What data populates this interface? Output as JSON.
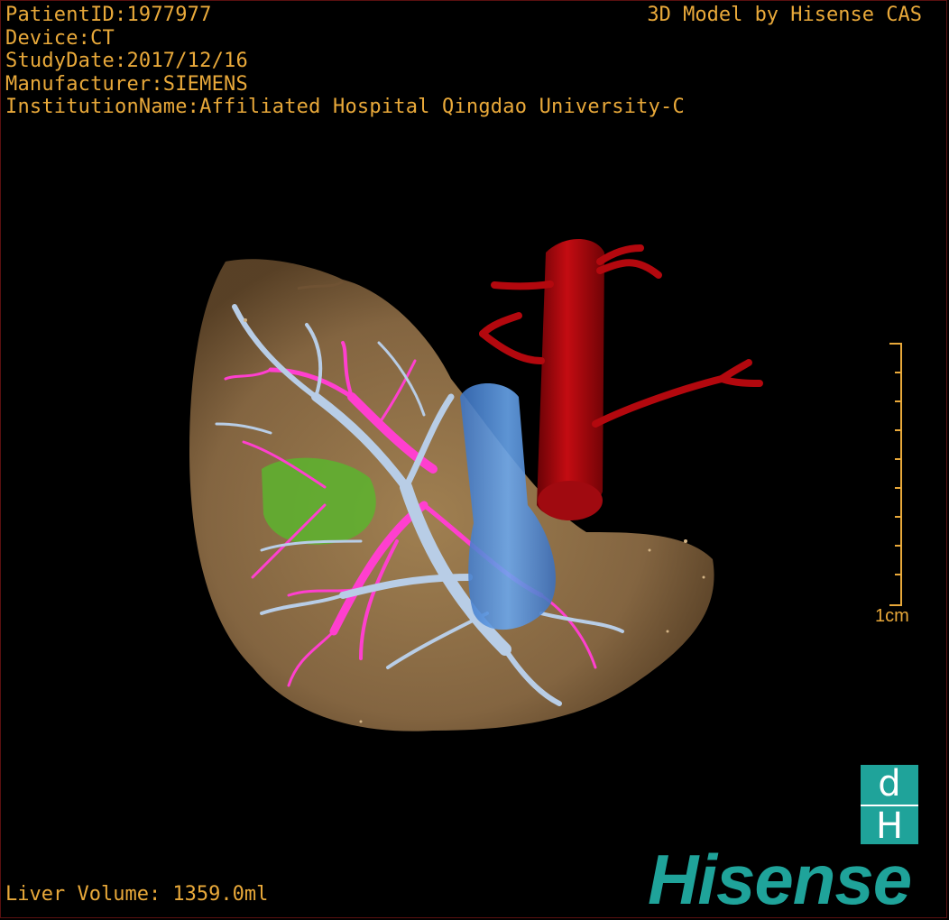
{
  "header": {
    "patient_id": "PatientID:1977977",
    "device": "Device:CT",
    "study_date": "StudyDate:2017/12/16",
    "manufacturer": "Manufacturer:SIEMENS",
    "institution": "InstitutionName:Affiliated Hospital Qingdao University-C"
  },
  "credit": "3D Model by Hisense CAS",
  "footer": {
    "liver_volume": "Liver Volume: 1359.0ml"
  },
  "scale": {
    "label": "1cm"
  },
  "logo": {
    "mark_top": "d",
    "mark_bottom": "H",
    "wordmark": "Hisense"
  },
  "colors": {
    "text": "#e9a93a",
    "liver": "#8a6a44",
    "portal_vein": "#b8cde6",
    "hepatic_artery": "#ff3fcf",
    "vena_cava": "#5a94e0",
    "aorta": "#b3080e",
    "tumor": "#5cb42e",
    "brand": "#1fa39a"
  },
  "icons": [
    "liver-3d-model-icon",
    "hisense-logo-icon"
  ]
}
